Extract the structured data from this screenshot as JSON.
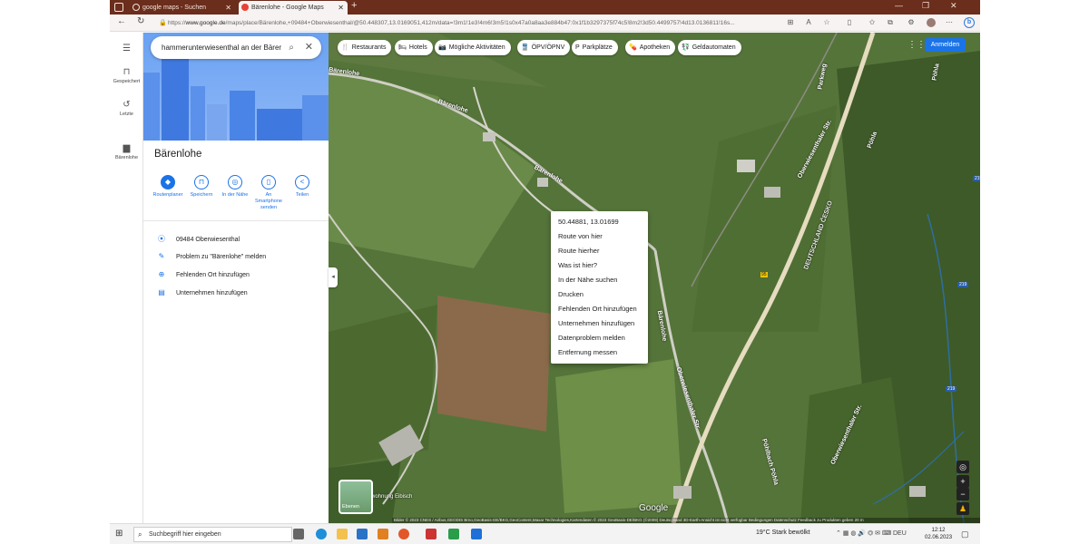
{
  "browser": {
    "tabs": [
      {
        "label": "google maps - Suchen",
        "close": "✕"
      },
      {
        "label": "Bärenlohe - Google Maps",
        "close": "✕"
      }
    ],
    "new_tab": "+",
    "window_controls": [
      "—",
      "❐",
      "✕"
    ],
    "url_prefix": "https://",
    "url_domain": "www.google.de",
    "url_rest": "/maps/place/Bärenlohe,+09484+Oberwiesenthal/@50.448307,13.0169051,412m/data=!3m1!1e3!4m6!3m5!1s0x47a0a8aa3e884b47:0x1f1b3297375f74c5!8m2!3d50.4499757!4d13.0136811!16s..."
  },
  "rail": {
    "items": [
      {
        "label": "",
        "icon": "menu-icon"
      },
      {
        "label": "Gespeichert",
        "icon": "bookmark-icon"
      },
      {
        "label": "Letzte",
        "icon": "history-icon"
      },
      {
        "label": "Bärenlohe",
        "icon": "place-icon"
      }
    ]
  },
  "panel": {
    "search_value": "hammerunterwiesenthal an der Bärer",
    "place_title": "Bärenlohe",
    "actions": [
      {
        "label": "Routenplaner",
        "icon": "directions-icon"
      },
      {
        "label": "Speichern",
        "icon": "bookmark-icon"
      },
      {
        "label": "In der Nähe",
        "icon": "nearby-icon"
      },
      {
        "label": "An Smartphone senden",
        "icon": "phone-icon"
      },
      {
        "label": "Teilen",
        "icon": "share-icon"
      }
    ],
    "info": [
      {
        "text": "09484 Oberwiesenthal",
        "icon": "pin-icon"
      },
      {
        "text": "Problem zu \"Bärenlohe\" melden",
        "icon": "pencil-icon"
      },
      {
        "text": "Fehlenden Ort hinzufügen",
        "icon": "add-place-icon"
      },
      {
        "text": "Unternehmen hinzufügen",
        "icon": "add-business-icon"
      }
    ]
  },
  "map": {
    "chips": [
      {
        "label": "Restaurants",
        "icon": "🍴"
      },
      {
        "label": "Hotels",
        "icon": "🛏"
      },
      {
        "label": "Mögliche Aktivitäten",
        "icon": "📷"
      },
      {
        "label": "ÖPV/ÖPNV",
        "icon": "🚆"
      },
      {
        "label": "Parkplätze",
        "icon": "P"
      },
      {
        "label": "Apotheken",
        "icon": "💊"
      },
      {
        "label": "Geldautomaten",
        "icon": "💱"
      }
    ],
    "signin": "Anmelden",
    "roads": [
      "Bärenlohe",
      "Bärenlohe",
      "Bärenlohe",
      "Oberwiesenthaler Str.",
      "Oberwiesenthaler Str.",
      "Bärenlohe",
      "Parkweg",
      "Pöhla",
      "Pöhla",
      "Pöhlbach Pöhla",
      "DEUTSCHLAND ČESKO",
      "Oberwiesenthaler Str."
    ],
    "shields": [
      "219",
      "219",
      "219",
      "95"
    ],
    "context_menu": {
      "coords": "50.44881, 13.01699",
      "items": [
        "Route von hier",
        "Route hierher",
        "Was ist hier?",
        "In der Nähe suchen",
        "Drucken",
        "Fehlenden Ort hinzufügen",
        "Unternehmen hinzufügen",
        "Datenproblem melden",
        "Entfernung messen"
      ]
    },
    "layers_label": "Ebenen",
    "poi_label": "Ferienwohnung Eibisch",
    "google": "Google",
    "attribution": "Bilder © 2023 CNES / Airbus,GEODIS Brno,GeoBasis-DE/BKG,GeoContent,Maxar Technologies,Kartendaten © 2023 GeoBasis-DE/BKG (©2009)   Deutschland   3D-Earth-Ansicht ist nicht verfügbar   Bedingungen   Datenschutz   Feedback zu Produkten geben   20 m"
  },
  "taskbar": {
    "search_placeholder": "Suchbegriff hier eingeben",
    "weather": "19°C  Stark bewölkt",
    "lang": "DEU",
    "time": "12:12",
    "date": "02.06.2023"
  }
}
